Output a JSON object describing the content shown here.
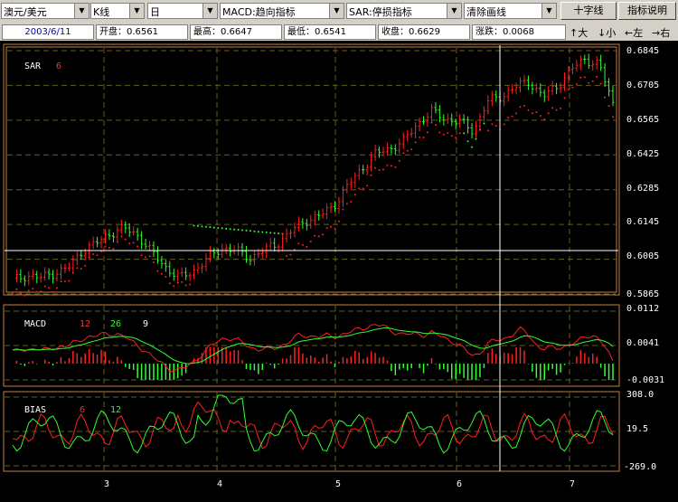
{
  "toolbar": {
    "symbol": "澳元/美元",
    "chart_type": "K线",
    "period": "日",
    "indicator1": "MACD:趋向指标",
    "indicator2": "SAR:停损指标",
    "draw_tool": "清除画线",
    "crosshair_button": "十字线",
    "help_button": "指标说明"
  },
  "quote": {
    "date": "2003/6/11",
    "open": "开盘：0.6561",
    "high": "最高：0.6647",
    "low": "最低：0.6541",
    "close": "收盘：0.6629",
    "change": "涨跌：0.0068"
  },
  "nav": {
    "zoom_in": "↑大",
    "zoom_out": "↓小",
    "left": "←左",
    "right": "→右"
  },
  "main_panel": {
    "name": "SAR",
    "param": "6",
    "price_ticks": [
      "0.6845",
      "0.6705",
      "0.6565",
      "0.6425",
      "0.6285",
      "0.6145",
      "0.6005",
      "0.5865"
    ]
  },
  "macd_panel": {
    "name": "MACD",
    "params": [
      "12",
      "26",
      "9"
    ],
    "ticks": [
      "0.0112",
      "0.0041",
      "-0.0031"
    ]
  },
  "bias_panel": {
    "name": "BIAS",
    "params": [
      "6",
      "12"
    ],
    "ticks": [
      "308.0",
      "19.5",
      "-269.0"
    ]
  },
  "x_labels": [
    "3",
    "4",
    "5",
    "6",
    "7"
  ],
  "colors": {
    "up": "#ff2020",
    "down": "#30ff30",
    "frame": "#c08040",
    "grid": "#606020",
    "axis_text": "#ffffff"
  },
  "chart_data": {
    "type": "candlestick",
    "x_axis_labels": [
      "3",
      "4",
      "5",
      "6",
      "7"
    ],
    "y_ticks": [
      0.6845,
      0.6705,
      0.6565,
      0.6425,
      0.6285,
      0.6145,
      0.6005,
      0.5865
    ],
    "close_series_approx": [
      0.592,
      0.594,
      0.593,
      0.595,
      0.597,
      0.604,
      0.607,
      0.611,
      0.613,
      0.61,
      0.603,
      0.597,
      0.593,
      0.596,
      0.601,
      0.605,
      0.604,
      0.601,
      0.604,
      0.607,
      0.612,
      0.616,
      0.618,
      0.622,
      0.63,
      0.637,
      0.643,
      0.645,
      0.648,
      0.655,
      0.66,
      0.657,
      0.656,
      0.652,
      0.664,
      0.666,
      0.67,
      0.672,
      0.666,
      0.67,
      0.677,
      0.681,
      0.679,
      0.663
    ],
    "macd_ticks": [
      0.0112,
      0.0041,
      -0.0031
    ],
    "bias_ticks": [
      308.0,
      19.5,
      -269.0
    ]
  }
}
